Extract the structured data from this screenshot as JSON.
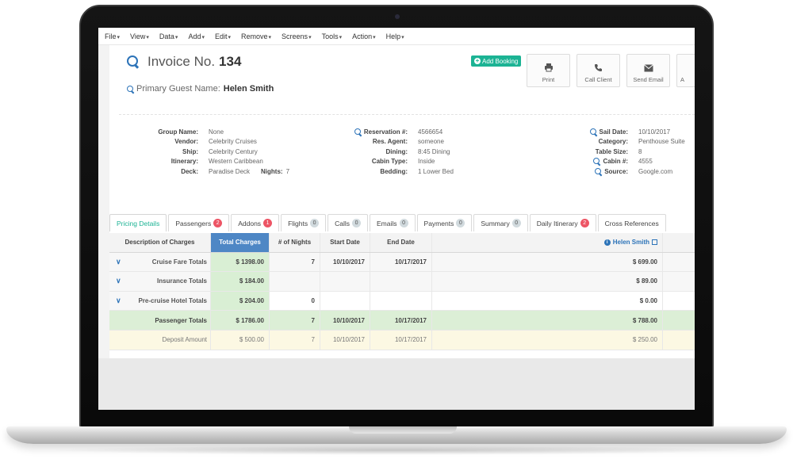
{
  "menu": [
    "File",
    "View",
    "Data",
    "Add",
    "Edit",
    "Remove",
    "Screens",
    "Tools",
    "Action",
    "Help"
  ],
  "invoice": {
    "prefix": "Invoice No.",
    "number": "134"
  },
  "guest": {
    "label": "Primary Guest Name:",
    "name": "Helen Smith"
  },
  "add_booking": "Add Booking",
  "tools": [
    {
      "label": "Print",
      "icon": "print-icon"
    },
    {
      "label": "Call Client",
      "icon": "phone-icon"
    },
    {
      "label": "Send Email",
      "icon": "envelope-icon"
    },
    {
      "label": "A",
      "icon": ""
    }
  ],
  "details": {
    "col1": [
      {
        "label": "Group Name:",
        "value": "None"
      },
      {
        "label": "Vendor:",
        "value": "Celebrity Cruises"
      },
      {
        "label": "Ship:",
        "value": "Celebrity Century"
      },
      {
        "label": "Itinerary:",
        "value": "Western Caribbean"
      },
      {
        "label": "Deck:",
        "value": "Paradise Deck"
      }
    ],
    "nights": {
      "label": "Nights:",
      "value": "7"
    },
    "col2": [
      {
        "label": "Reservation #:",
        "value": "4566654",
        "search": true
      },
      {
        "label": "Res. Agent:",
        "value": "someone"
      },
      {
        "label": "Dining:",
        "value": "8:45 Dining"
      },
      {
        "label": "Cabin Type:",
        "value": "Inside"
      },
      {
        "label": "Bedding:",
        "value": "1 Lower Bed"
      }
    ],
    "col3": [
      {
        "label": "Sail Date:",
        "value": "10/10/2017",
        "search": true
      },
      {
        "label": "Category:",
        "value": "Penthouse Suite"
      },
      {
        "label": "Table Size:",
        "value": "8"
      },
      {
        "label": "Cabin #:",
        "value": "4555",
        "search": true
      },
      {
        "label": "Source:",
        "value": "Google.com",
        "search": true
      }
    ]
  },
  "tabs": [
    {
      "label": "Pricing Details",
      "badge": "",
      "badge_color": ""
    },
    {
      "label": "Passengers",
      "badge": "2",
      "badge_color": "red"
    },
    {
      "label": "Addons",
      "badge": "1",
      "badge_color": "red"
    },
    {
      "label": "Flights",
      "badge": "0",
      "badge_color": "gray"
    },
    {
      "label": "Calls",
      "badge": "0",
      "badge_color": "gray"
    },
    {
      "label": "Emails",
      "badge": "0",
      "badge_color": "gray"
    },
    {
      "label": "Payments",
      "badge": "0",
      "badge_color": "gray"
    },
    {
      "label": "Summary",
      "badge": "0",
      "badge_color": "gray"
    },
    {
      "label": "Daily Itinerary",
      "badge": "2",
      "badge_color": "red"
    },
    {
      "label": "Cross References",
      "badge": "",
      "badge_color": ""
    }
  ],
  "table": {
    "headers": [
      "Description of Charges",
      "Total Charges",
      "# of Nights",
      "Start Date",
      "End Date"
    ],
    "guest_col": "Helen Smith",
    "rows": [
      {
        "desc": "Cruise Fare Totals",
        "total": "$ 1398.00",
        "nights": "7",
        "start": "10/10/2017",
        "end": "10/17/2017",
        "guest": "$ 699.00"
      },
      {
        "desc": "Insurance Totals",
        "total": "$ 184.00",
        "nights": "",
        "start": "",
        "end": "",
        "guest": "$ 89.00"
      },
      {
        "desc": "Pre-cruise Hotel Totals",
        "total": "$ 204.00",
        "nights": "0",
        "start": "",
        "end": "",
        "guest": "$ 0.00"
      }
    ],
    "totals": {
      "desc": "Passenger Totals",
      "total": "$ 1786.00",
      "nights": "7",
      "start": "10/10/2017",
      "end": "10/17/2017",
      "guest": "$ 788.00"
    },
    "deposit": {
      "desc": "Deposit Amount",
      "total": "$ 500.00",
      "nights": "7",
      "start": "10/10/2017",
      "end": "10/17/2017",
      "guest": "$ 250.00"
    }
  }
}
